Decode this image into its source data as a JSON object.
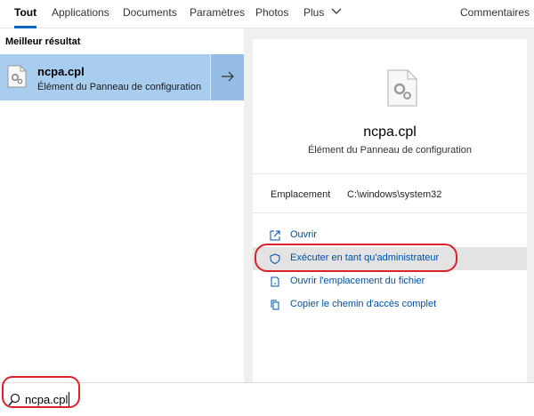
{
  "tabs": [
    {
      "label": "Tout",
      "active": true
    },
    {
      "label": "Applications"
    },
    {
      "label": "Documents"
    },
    {
      "label": "Paramètres"
    },
    {
      "label": "Photos"
    },
    {
      "label": "Plus"
    }
  ],
  "feedback_label": "Commentaires",
  "left": {
    "section_title": "Meilleur résultat",
    "best_match": {
      "name": "ncpa.cpl",
      "subtitle": "Élément du Panneau de configuration",
      "icon": "control-panel-file-icon"
    }
  },
  "preview": {
    "title": "ncpa.cpl",
    "subtitle": "Élément du Panneau de configuration",
    "location_label": "Emplacement",
    "location_value": "C:\\windows\\system32",
    "actions": [
      {
        "label": "Ouvrir",
        "icon": "open-icon"
      },
      {
        "label": "Exécuter en tant qu'administrateur",
        "icon": "shield-icon",
        "highlighted": true
      },
      {
        "label": "Ouvrir l'emplacement du fichier",
        "icon": "file-location-icon"
      },
      {
        "label": "Copier le chemin d'accès complet",
        "icon": "copy-icon"
      }
    ]
  },
  "search": {
    "value": "ncpa.cpl"
  },
  "colors": {
    "accent": "#0067c0",
    "selection": "#a9cdef",
    "annotation": "#d9222a",
    "link": "#0050a8"
  }
}
